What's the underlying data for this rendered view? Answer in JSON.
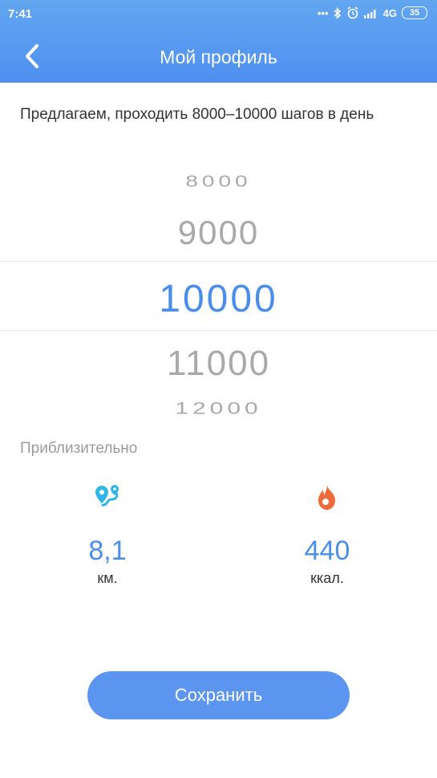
{
  "status_bar": {
    "time": "7:41",
    "network": "4G",
    "battery": "35"
  },
  "header": {
    "title": "Мой профиль",
    "back_icon": "chevron-left-icon"
  },
  "suggestion_text": "Предлагаем, проходить 8000–10000 шагов в день",
  "picker": {
    "options": [
      "8000",
      "9000",
      "10000",
      "11000",
      "12000"
    ],
    "selected": "10000"
  },
  "approx_label": "Приблизительно",
  "stats": {
    "distance": {
      "value": "8,1",
      "unit": "км.",
      "icon": "map-pin-route-icon",
      "color": "#2fb5e6"
    },
    "calories": {
      "value": "440",
      "unit": "ккал.",
      "icon": "flame-icon",
      "color": "#ef6a3a"
    }
  },
  "save_button": "Сохранить",
  "colors": {
    "accent": "#4a8ee8",
    "header_gradient_top": "#62a6f0",
    "header_gradient_bottom": "#4f8ff0",
    "button": "#5b95ef"
  }
}
